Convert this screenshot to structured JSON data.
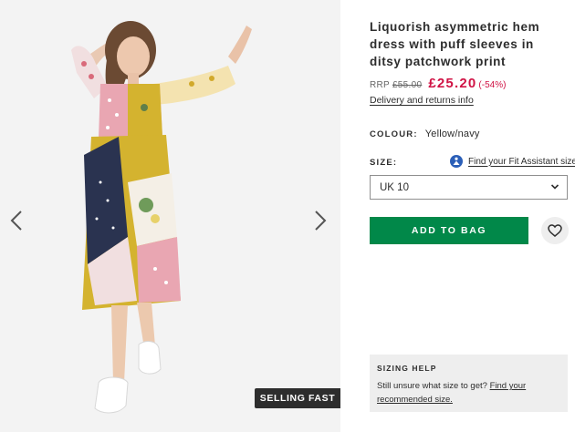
{
  "product": {
    "title": "Liquorish asymmetric hem dress with puff sleeves in ditsy patchwork print",
    "rrp_label": "RRP",
    "rrp_price": "£55.00",
    "sale_price": "£25.20",
    "discount": "(-54%)",
    "returns_link": "Delivery and returns info"
  },
  "colour": {
    "label": "COLOUR:",
    "value": "Yellow/navy"
  },
  "size": {
    "label": "SIZE:",
    "fit_link": "Find your Fit Assistant size",
    "selected": "UK 10"
  },
  "actions": {
    "add_to_bag": "ADD TO BAG"
  },
  "gallery": {
    "badge": "SELLING FAST"
  },
  "sizing_help": {
    "heading": "SIZING HELP",
    "text": "Still unsure what size to get?",
    "link": "Find your recommended size."
  },
  "colors": {
    "accent_green": "#018849",
    "sale_red": "#d01345",
    "dark": "#2d2d2d",
    "panel_gray": "#eeeeee"
  }
}
